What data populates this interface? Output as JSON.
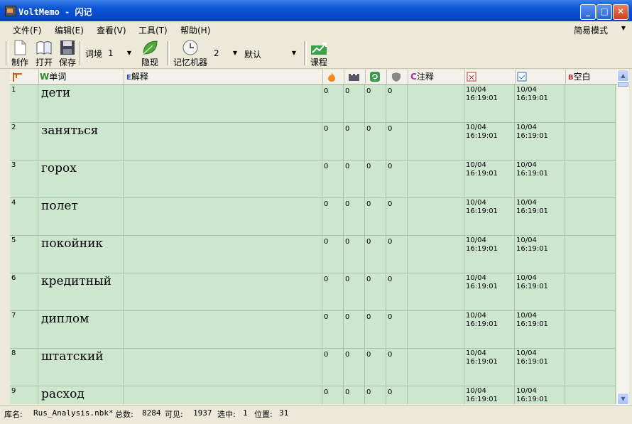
{
  "window": {
    "title": "VoltMemo - 闪记"
  },
  "menu": [
    "文件(F)",
    "编辑(E)",
    "查看(V)",
    "工具(T)",
    "帮助(H)"
  ],
  "mode_select": "简易模式",
  "toolbar": {
    "make": "制作",
    "open": "打开",
    "save": "保存",
    "context_label": "词境",
    "context_value": "1",
    "hide": "隐现",
    "memory_label": "记忆机器",
    "memory_value": "2",
    "memory_mode": "默认",
    "course": "课程"
  },
  "columns": {
    "word": "单词",
    "meaning": "解释",
    "note": "注释",
    "blank": "空白"
  },
  "rows": [
    {
      "n": "1",
      "word": "дети",
      "a": "0",
      "b": "0",
      "c": "0",
      "d": "0",
      "d1": "10/04",
      "t1": "16:19:01",
      "d2": "10/04",
      "t2": "16:19:01"
    },
    {
      "n": "2",
      "word": "заняться",
      "a": "0",
      "b": "0",
      "c": "0",
      "d": "0",
      "d1": "10/04",
      "t1": "16:19:01",
      "d2": "10/04",
      "t2": "16:19:01"
    },
    {
      "n": "3",
      "word": "горох",
      "a": "0",
      "b": "0",
      "c": "0",
      "d": "0",
      "d1": "10/04",
      "t1": "16:19:01",
      "d2": "10/04",
      "t2": "16:19:01"
    },
    {
      "n": "4",
      "word": "полет",
      "a": "0",
      "b": "0",
      "c": "0",
      "d": "0",
      "d1": "10/04",
      "t1": "16:19:01",
      "d2": "10/04",
      "t2": "16:19:01"
    },
    {
      "n": "5",
      "word": "покойник",
      "a": "0",
      "b": "0",
      "c": "0",
      "d": "0",
      "d1": "10/04",
      "t1": "16:19:01",
      "d2": "10/04",
      "t2": "16:19:01"
    },
    {
      "n": "6",
      "word": "кредитный",
      "a": "0",
      "b": "0",
      "c": "0",
      "d": "0",
      "d1": "10/04",
      "t1": "16:19:01",
      "d2": "10/04",
      "t2": "16:19:01"
    },
    {
      "n": "7",
      "word": "диплом",
      "a": "0",
      "b": "0",
      "c": "0",
      "d": "0",
      "d1": "10/04",
      "t1": "16:19:01",
      "d2": "10/04",
      "t2": "16:19:01"
    },
    {
      "n": "8",
      "word": "штатский",
      "a": "0",
      "b": "0",
      "c": "0",
      "d": "0",
      "d1": "10/04",
      "t1": "16:19:01",
      "d2": "10/04",
      "t2": "16:19:01"
    },
    {
      "n": "9",
      "word": "расход",
      "a": "0",
      "b": "0",
      "c": "0",
      "d": "0",
      "d1": "10/04",
      "t1": "16:19:01",
      "d2": "10/04",
      "t2": "16:19:01"
    }
  ],
  "status": {
    "lib_label": "库名:",
    "lib_name": "Rus_Analysis.nbk*",
    "total_label": "总数:",
    "total": "8284",
    "visible_label": "可见:",
    "visible": "1937",
    "selected_label": "选中:",
    "selected": "1",
    "position_label": "位置:",
    "position": "31"
  }
}
